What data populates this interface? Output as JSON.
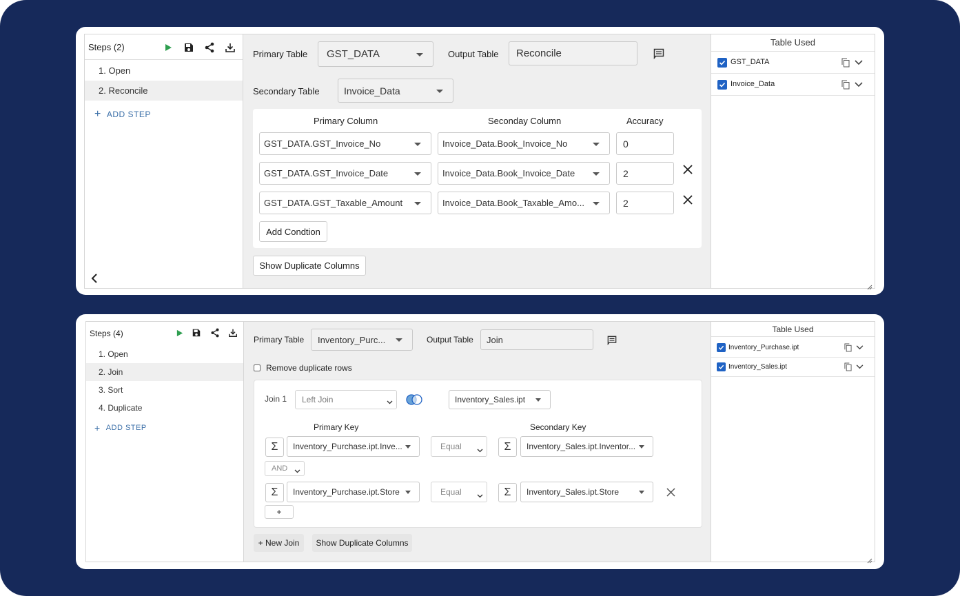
{
  "panel1": {
    "steps_title": "Steps (2)",
    "steps": [
      "1. Open",
      "2. Reconcile"
    ],
    "active_step": 1,
    "add_step_label": "ADD STEP",
    "primary_table_label": "Primary Table",
    "primary_table_value": "GST_DATA",
    "output_table_label": "Output Table",
    "output_table_value": "Reconcile",
    "secondary_table_label": "Secondary Table",
    "secondary_table_value": "Invoice_Data",
    "col_headers": {
      "primary": "Primary Column",
      "secondary": "Seconday Column",
      "accuracy": "Accuracy"
    },
    "rows": [
      {
        "primary": "GST_DATA.GST_Invoice_No",
        "secondary": "Invoice_Data.Book_Invoice_No",
        "accuracy": "0"
      },
      {
        "primary": "GST_DATA.GST_Invoice_Date",
        "secondary": "Invoice_Data.Book_Invoice_Date",
        "accuracy": "2"
      },
      {
        "primary": "GST_DATA.GST_Taxable_Amount",
        "secondary": "Invoice_Data.Book_Taxable_Amo...",
        "accuracy": "2"
      }
    ],
    "add_condition_label": "Add Condtion",
    "show_dup_label": "Show Duplicate Columns",
    "table_used_title": "Table Used",
    "tables": [
      "GST_DATA",
      "Invoice_Data"
    ]
  },
  "panel2": {
    "steps_title": "Steps (4)",
    "steps": [
      "1. Open",
      "2. Join",
      "3. Sort",
      "4. Duplicate"
    ],
    "active_step": 1,
    "add_step_label": "ADD STEP",
    "primary_table_label": "Primary Table",
    "primary_table_value": "Inventory_Purc...",
    "output_table_label": "Output Table",
    "output_table_value": "Join",
    "remove_dup_label": "Remove duplicate rows",
    "join_label": "Join 1",
    "join_type": "Left Join",
    "join_table": "Inventory_Sales.ipt",
    "primary_key_header": "Primary Key",
    "secondary_key_header": "Secondary Key",
    "keys": [
      {
        "primary": "Inventory_Purchase.ipt.Inve...",
        "op": "Equal",
        "secondary": "Inventory_Sales.ipt.Inventor..."
      },
      {
        "primary": "Inventory_Purchase.ipt.Store",
        "op": "Equal",
        "secondary": "Inventory_Sales.ipt.Store"
      }
    ],
    "connector": "AND",
    "add_key_label": "+",
    "sigma": "Σ",
    "new_join_label": "+ New Join",
    "show_dup_label": "Show Duplicate Columns",
    "table_used_title": "Table Used",
    "tables": [
      "Inventory_Purchase.ipt",
      "Inventory_Sales.ipt"
    ]
  },
  "colors": {
    "background": "#16295a",
    "accent": "#1f62c4",
    "run": "#2e9e4f",
    "link": "#3b6fa8"
  }
}
